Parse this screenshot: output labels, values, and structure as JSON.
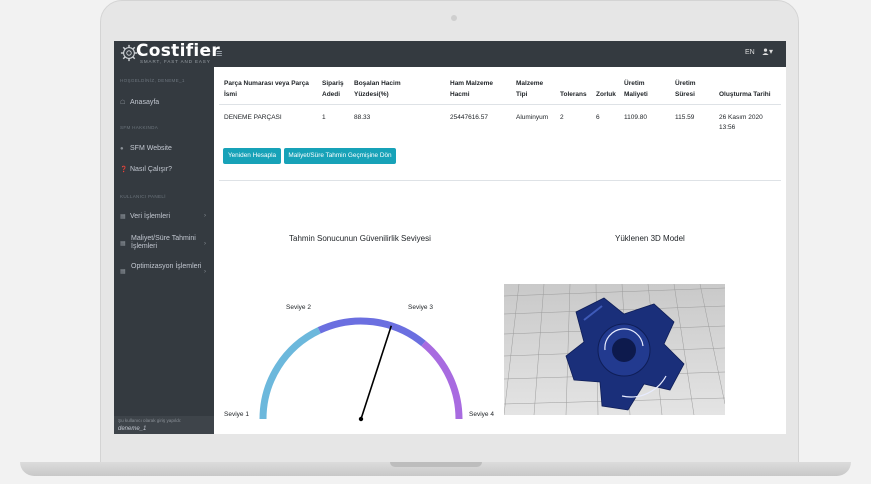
{
  "brand": {
    "name": "Costifier",
    "tagline": "SMART, FAST AND EASY"
  },
  "topbar": {
    "lang": "EN",
    "user_menu": "▾",
    "menu_icon": "hamburger-icon",
    "user_icon": "user-icon"
  },
  "sidebar": {
    "greeting": "HOŞGELDİNİZ, DENEME_1",
    "sections": [
      {
        "title": "",
        "items": [
          {
            "label": "Anasayfa",
            "icon": "home-icon"
          }
        ]
      },
      {
        "title": "SFM HAKKINDA",
        "items": [
          {
            "label": "SFM Website",
            "icon": "globe-icon"
          },
          {
            "label": "Nasıl Çalışır?",
            "icon": "question-icon"
          }
        ]
      },
      {
        "title": "KULLANICI PANELİ",
        "items": [
          {
            "label": "Veri İşlemleri",
            "icon": "table-icon"
          },
          {
            "label": "Maliyet/Süre Tahmini İşlemleri",
            "icon": "table-icon"
          },
          {
            "label": "Optimizasyon İşlemleri",
            "icon": "table-icon"
          }
        ]
      }
    ],
    "footer_note": "Şu kullanıcı olarak giriş yapıldı:",
    "footer_user": "deneme_1"
  },
  "table": {
    "headers": [
      "Parça Numarası veya Parça İsmi",
      "Sipariş Adedi",
      "Boşalan Hacim Yüzdesi(%)",
      "Ham Malzeme Hacmi",
      "Malzeme Tipi",
      "Tolerans",
      "Zorluk",
      "Üretim Maliyeti",
      "Üretim Süresi",
      "Oluşturma Tarihi"
    ],
    "row": [
      "DENEME PARÇASI",
      "1",
      "88.33",
      "25447616.57",
      "Aluminyum",
      "2",
      "6",
      "1109.80",
      "115.59",
      "26 Kasım 2020 13:56"
    ]
  },
  "buttons": {
    "recalc": "Yeniden Hesapla",
    "back": "Maliyet/Süre Tahmin Geçmişine Dön"
  },
  "gauge": {
    "title": "Tahmin Sonucunun Güvenilirlik Seviyesi",
    "labels": [
      "Seviye 1",
      "Seviye 2",
      "Seviye 3",
      "Seviye 4"
    ],
    "colors": [
      "#6cb8dc",
      "#6b6fe0",
      "#a86be0"
    ],
    "needle_level_fraction": 0.6
  },
  "model": {
    "title": "Yüklenen 3D Model",
    "part_color": "#1a2f7a"
  }
}
